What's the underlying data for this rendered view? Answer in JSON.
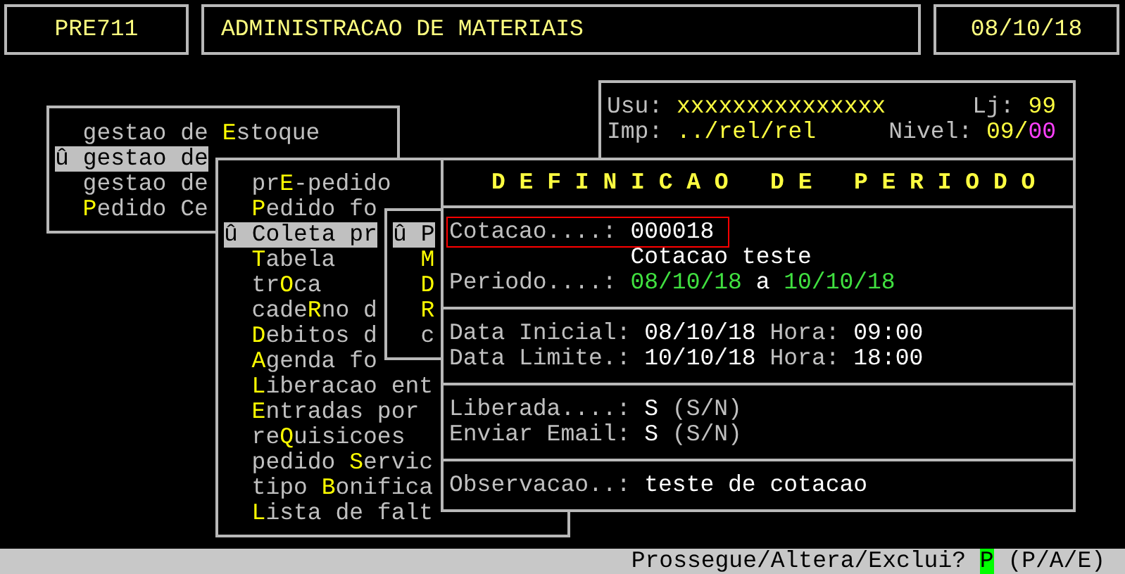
{
  "header": {
    "program": "PRE711",
    "title": "ADMINISTRACAO DE MATERIAIS",
    "date": "08/10/18"
  },
  "session": {
    "user_label": "Usu:",
    "user": "xxxxxxxxxxxxxxx",
    "store_label": "Lj:",
    "store": "99",
    "printer_label": "Imp:",
    "printer": "../rel/rel",
    "level_label": "Nivel:",
    "level_value": "09/",
    "level_sublevel": "00"
  },
  "menus": [
    {
      "items": [
        {
          "text_before": "gestao de ",
          "hotkey": "E",
          "text_after": "stoque",
          "selected": false
        },
        {
          "marker": "û",
          "text_before": "gestao de",
          "selected": true
        },
        {
          "text_before": "gestao de",
          "selected": false
        },
        {
          "hotkey": "P",
          "text_after": "edido Ce",
          "selected": false
        }
      ]
    },
    {
      "items": [
        {
          "text_before": "pr",
          "hotkey": "E",
          "text_after": "-pedido",
          "selected": false
        },
        {
          "hotkey": "P",
          "text_after": "edido fo",
          "selected": false
        },
        {
          "marker": "û",
          "text_before": "Coleta pr",
          "selected": true
        },
        {
          "hotkey": "T",
          "text_after": "abela",
          "selected": false
        },
        {
          "text_before": "tr",
          "hotkey": "O",
          "text_after": "ca",
          "selected": false
        },
        {
          "text_before": "cade",
          "hotkey": "R",
          "text_after": "no d",
          "selected": false
        },
        {
          "hotkey": "D",
          "text_after": "ebitos d",
          "selected": false
        },
        {
          "hotkey": "A",
          "text_after": "genda fo",
          "selected": false
        },
        {
          "hotkey": "L",
          "text_after": "iberacao ent",
          "selected": false
        },
        {
          "hotkey": "E",
          "text_after": "ntradas por",
          "selected": false
        },
        {
          "text_before": "re",
          "hotkey": "Q",
          "text_after": "uisicoes",
          "selected": false
        },
        {
          "text_before": "pedido ",
          "hotkey": "S",
          "text_after": "ervic",
          "selected": false
        },
        {
          "text_before": "tipo ",
          "hotkey": "B",
          "text_after": "onifica",
          "selected": false
        },
        {
          "hotkey": "L",
          "text_after": "ista de falt",
          "selected": false
        }
      ]
    },
    {
      "items": [
        {
          "marker": "û",
          "text_before": "P",
          "selected": true
        },
        {
          "hotkey": "M",
          "selected": false
        },
        {
          "hotkey": "D",
          "selected": false
        },
        {
          "hotkey": "R",
          "selected": false
        },
        {
          "text_before": "c",
          "selected": false
        }
      ]
    }
  ],
  "dialog": {
    "title": "D E F I N I C A O   D E   P E R I O D O",
    "sections": [
      [
        {
          "kind": "field",
          "highlighted": true,
          "parts": [
            {
              "kind": "label",
              "text": "Cotacao....:"
            },
            {
              "kind": "value",
              "text": "000018"
            }
          ]
        },
        {
          "kind": "continuation",
          "parts": [
            {
              "kind": "value",
              "text": "Cotacao teste"
            }
          ]
        },
        {
          "kind": "field",
          "parts": [
            {
              "kind": "label",
              "text": "Periodo....:"
            },
            {
              "kind": "date",
              "text": "08/10/18"
            },
            {
              "kind": "value",
              "text": "a"
            },
            {
              "kind": "date",
              "text": "10/10/18"
            }
          ]
        }
      ],
      [
        {
          "kind": "field",
          "parts": [
            {
              "kind": "label",
              "text": "Data Inicial:"
            },
            {
              "kind": "value",
              "text": "08/10/18"
            },
            {
              "kind": "label",
              "text": "Hora:"
            },
            {
              "kind": "value",
              "text": "09:00"
            }
          ]
        },
        {
          "kind": "field",
          "parts": [
            {
              "kind": "label",
              "text": "Data Limite.:"
            },
            {
              "kind": "value",
              "text": "10/10/18"
            },
            {
              "kind": "label",
              "text": "Hora:"
            },
            {
              "kind": "value",
              "text": "18:00"
            }
          ]
        }
      ],
      [
        {
          "kind": "field",
          "parts": [
            {
              "kind": "label",
              "text": "Liberada....:"
            },
            {
              "kind": "value",
              "text": "S"
            },
            {
              "kind": "label",
              "text": "(S/N)"
            }
          ]
        },
        {
          "kind": "field",
          "parts": [
            {
              "kind": "label",
              "text": "Enviar Email:"
            },
            {
              "kind": "value",
              "text": "S"
            },
            {
              "kind": "label",
              "text": "(S/N)"
            }
          ]
        }
      ],
      [
        {
          "kind": "field",
          "parts": [
            {
              "kind": "label",
              "text": "Observacao..:"
            },
            {
              "kind": "value",
              "text": "teste de cotacao"
            }
          ]
        }
      ]
    ]
  },
  "status_bar": {
    "prompt": "Prossegue/Altera/Exclui?",
    "value": "P",
    "hint": "(P/A/E)"
  }
}
